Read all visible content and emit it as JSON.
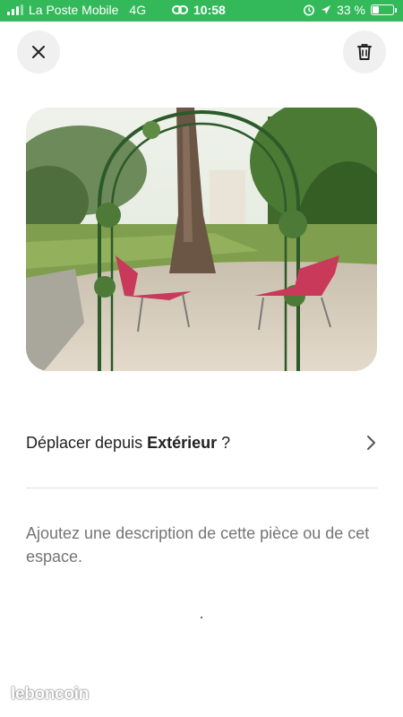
{
  "status_bar": {
    "carrier": "La Poste Mobile",
    "network": "4G",
    "time": "10:58",
    "battery_percent_label": "33 %",
    "battery_level": 0.33,
    "background_color": "#33b95a"
  },
  "header": {
    "close_icon": "close-icon",
    "delete_icon": "trash-icon"
  },
  "photo": {
    "subject": "garden-arch-photo"
  },
  "room": {
    "prefix": "Déplacer depuis ",
    "name": "Extérieur",
    "suffix": " ?"
  },
  "description": {
    "placeholder": "Ajoutez une description de cette pièce ou de cet espace."
  },
  "watermark": {
    "text": "leboncoin"
  }
}
